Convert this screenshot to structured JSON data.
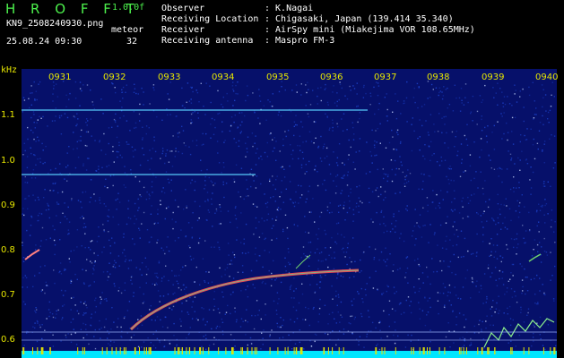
{
  "header": {
    "logo": "H R O F F T",
    "version": "1.0.0f",
    "filename": "KN9_2508240930.png",
    "datetime": "25.08.24 09:30",
    "mode": "meteor",
    "count": "32",
    "info": [
      {
        "label": "Observer",
        "value": ": K.Nagai"
      },
      {
        "label": "Receiving Location",
        "value": ": Chigasaki, Japan (139.414 35.340)"
      },
      {
        "label": "Receiver",
        "value": ": AirSpy mini (Miakejima VOR 108.65MHz)"
      },
      {
        "label": "Receiving antenna",
        "value": ": Maspro FM-3"
      }
    ]
  },
  "axes": {
    "y_unit": "kHz",
    "y_ticks": [
      "1.1",
      "1.0",
      "0.9",
      "0.8",
      "0.7",
      "0.6"
    ],
    "x_ticks": [
      "0931",
      "0932",
      "0933",
      "0934",
      "0935",
      "0936",
      "0937",
      "0938",
      "0939",
      "0940"
    ]
  },
  "colors": {
    "background": "#06106a",
    "noise": "#1e46d2",
    "trace": "#ff5050",
    "carrier": "#5ad2ff",
    "tick": "#e6e600"
  }
}
